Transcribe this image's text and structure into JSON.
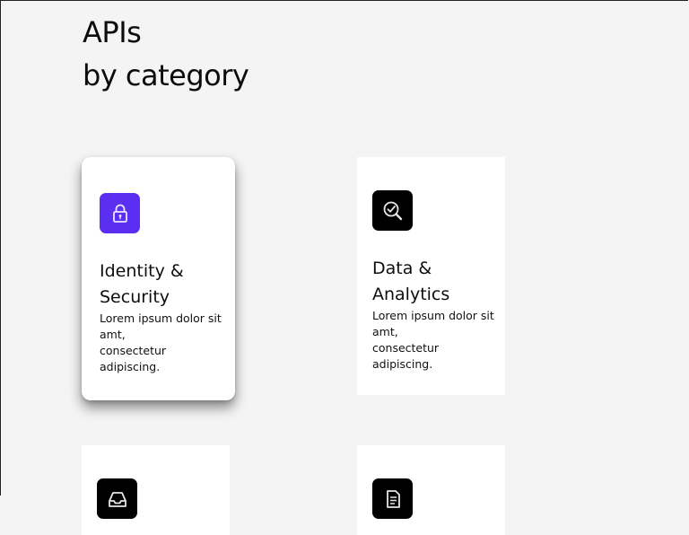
{
  "heading": {
    "line1": "APIs",
    "line2": "by category"
  },
  "cards": [
    {
      "title": "Identity &\nSecurity",
      "description": "Lorem ipsum dolor sit\namt,\nconsectetur\nadipiscing.",
      "icon": "lock-icon",
      "icon_color": "#5b2ff2"
    },
    {
      "title": "Data &\nAnalytics",
      "description": "Lorem ipsum dolor sit\namt,\nconsectetur\nadipiscing.",
      "icon": "magnifier-check-icon",
      "icon_color": "#000000"
    },
    {
      "icon": "inbox-icon",
      "icon_color": "#000000"
    },
    {
      "icon": "document-icon",
      "icon_color": "#000000"
    }
  ],
  "colors": {
    "background": "#f4f4f4",
    "card": "#ffffff",
    "accent": "#5b2ff2"
  }
}
